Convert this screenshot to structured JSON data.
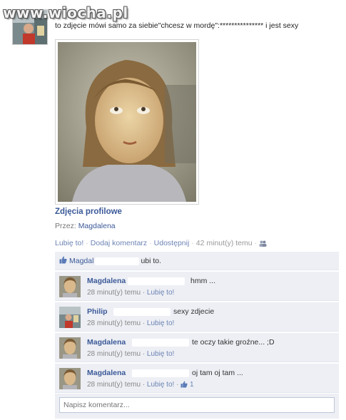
{
  "watermark": "www.wiocha.pl",
  "post": {
    "status_text": "to zdjęcie mówi samo za siebie\"chcesz w mordę\":*************** i jest sexy",
    "album_title": "Zdjęcia profilowe",
    "by_prefix": "Przez:",
    "by_name": "Magdalena"
  },
  "actions": {
    "like": "Lubię to!",
    "comment": "Dodaj komentarz",
    "share": "Udostępnij",
    "time": "42 minut(y) temu",
    "separator": "·"
  },
  "likes": {
    "name": "Magdal",
    "suffix": "ubi to."
  },
  "comments": [
    {
      "name": "Magdalena",
      "text": "hmm ...",
      "time": "28 minut(y) temu",
      "like": "Lubię to!"
    },
    {
      "name": "Philip",
      "text": "sexy zdjecie",
      "time": "28 minut(y) temu",
      "like": "Lubię to!"
    },
    {
      "name": "Magdalena",
      "text": "te oczy takie groźne... ;D",
      "time": "28 minut(y) temu",
      "like": "Lubię to!"
    },
    {
      "name": "Magdalena",
      "text": "oj tam oj tam ...",
      "time": "28 minut(y) temu",
      "like": "Lubię to!",
      "like_count": "1"
    }
  ],
  "comment_input": {
    "placeholder": "Napisz komentarz..."
  },
  "icons": {
    "like": "thumbs-up-icon",
    "audience": "friends-icon"
  },
  "colors": {
    "link": "#3b5998",
    "feedback_bg": "#edeff4"
  }
}
